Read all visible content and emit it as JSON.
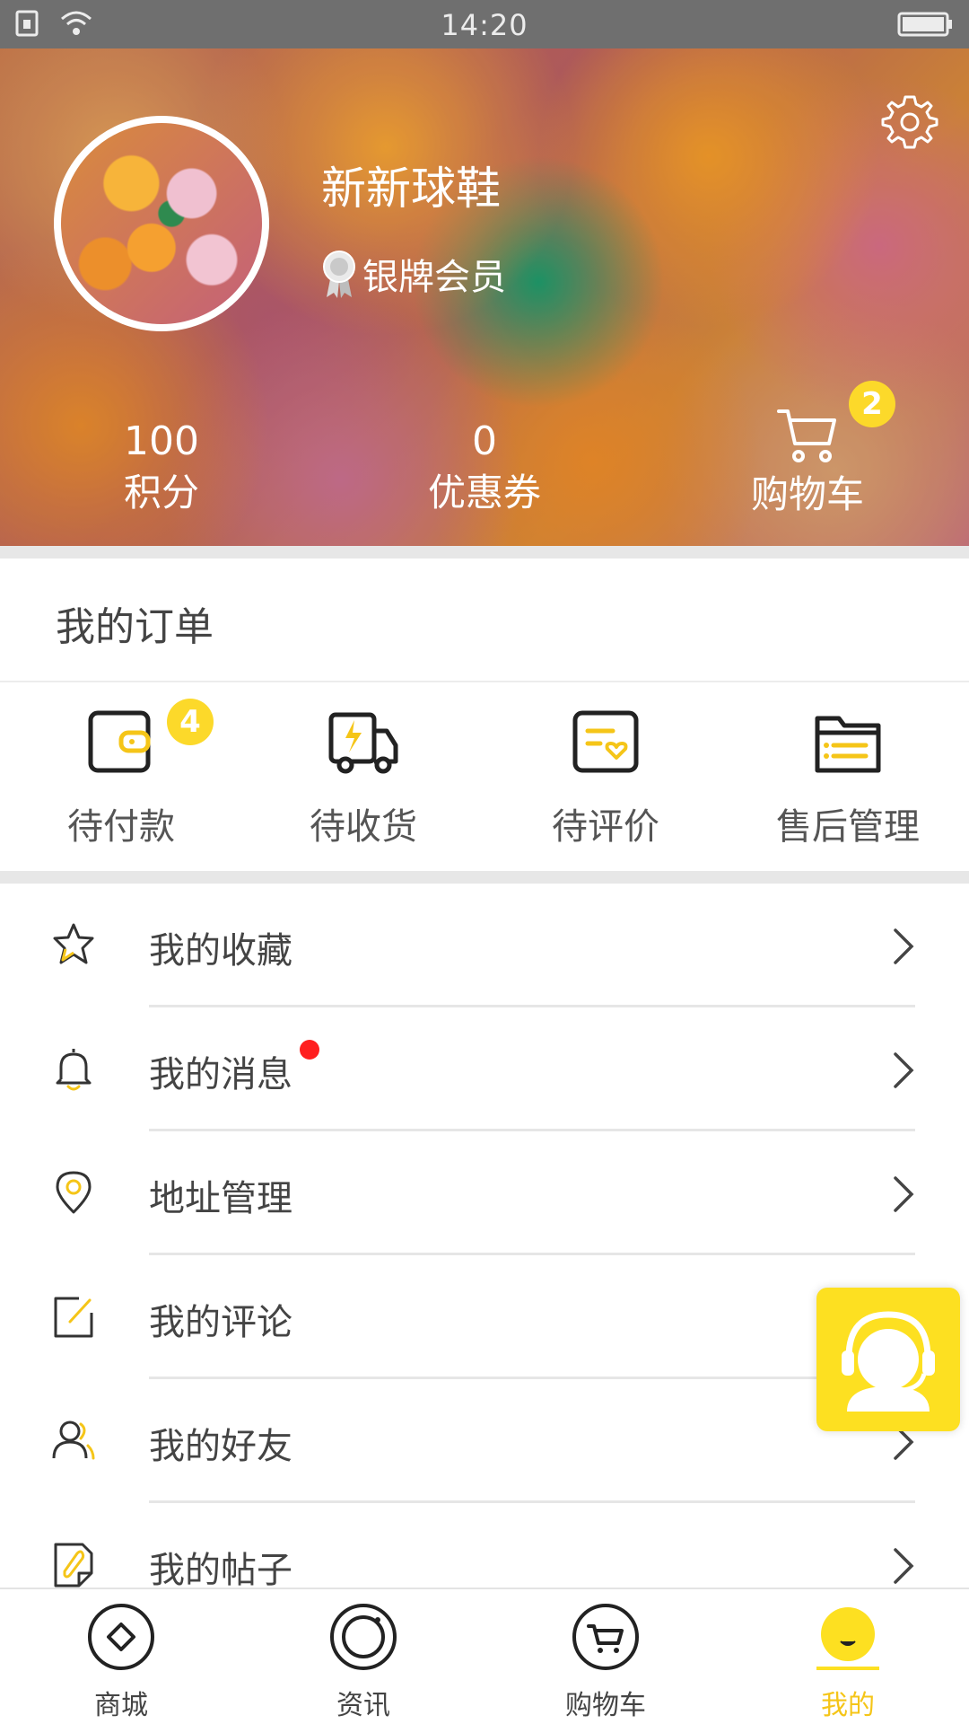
{
  "status_bar": {
    "time": "14:20"
  },
  "profile": {
    "username": "新新球鞋",
    "member_level": "银牌会员"
  },
  "stats": {
    "points": {
      "value": "100",
      "label": "积分"
    },
    "coupons": {
      "value": "0",
      "label": "优惠券"
    },
    "cart": {
      "label": "购物车",
      "badge": "2"
    }
  },
  "orders": {
    "title": "我的订单",
    "items": [
      {
        "label": "待付款",
        "icon": "wallet-icon",
        "badge": "4"
      },
      {
        "label": "待收货",
        "icon": "delivery-truck-icon"
      },
      {
        "label": "待评价",
        "icon": "review-icon"
      },
      {
        "label": "售后管理",
        "icon": "folder-icon"
      }
    ]
  },
  "menu": [
    {
      "label": "我的收藏",
      "icon": "star-icon"
    },
    {
      "label": "我的消息",
      "icon": "bell-icon",
      "unread": true
    },
    {
      "label": "地址管理",
      "icon": "location-pin-icon"
    },
    {
      "label": "我的评论",
      "icon": "edit-icon"
    },
    {
      "label": "我的好友",
      "icon": "friends-icon"
    },
    {
      "label": "我的帖子",
      "icon": "post-icon"
    }
  ],
  "tabbar": {
    "tabs": [
      {
        "label": "商城",
        "icon": "store-diamond-icon"
      },
      {
        "label": "资讯",
        "icon": "news-circle-icon"
      },
      {
        "label": "购物车",
        "icon": "cart-icon"
      },
      {
        "label": "我的",
        "icon": "smile-face-icon",
        "active": true
      }
    ]
  },
  "colors": {
    "accent": "#F5C518",
    "badge": "#FCD92A",
    "unread_dot": "#FF1F1F",
    "support": "#FDE021"
  }
}
